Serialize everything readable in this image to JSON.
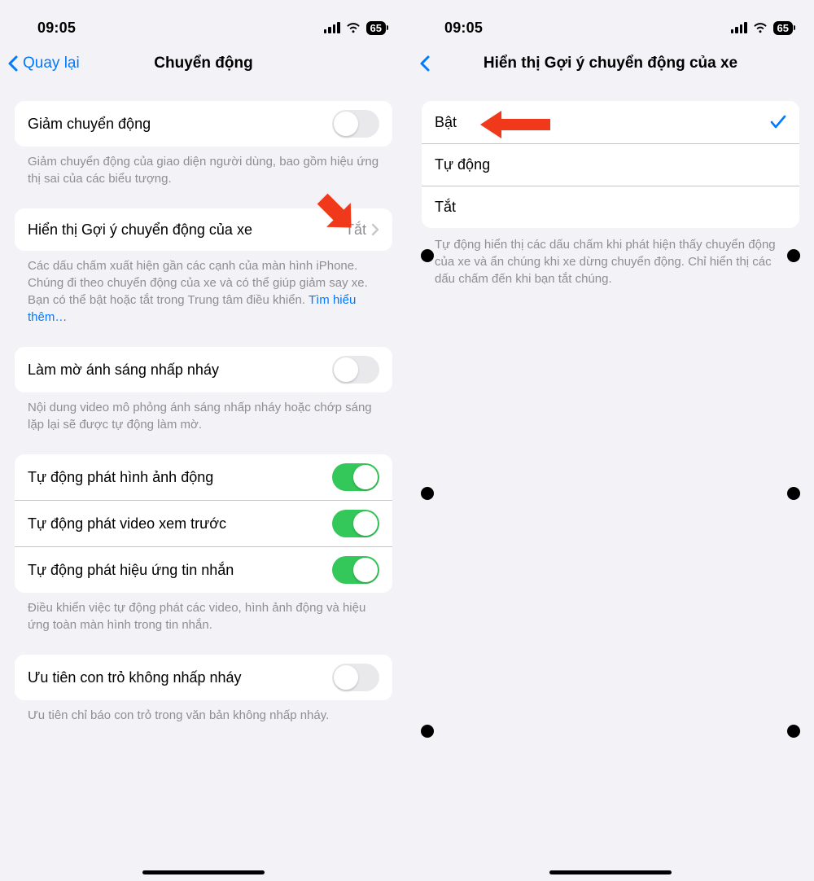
{
  "status": {
    "time": "09:05",
    "battery": "65"
  },
  "left": {
    "nav": {
      "back": "Quay lại",
      "title": "Chuyển động"
    },
    "reduce_motion": {
      "label": "Giảm chuyển động"
    },
    "reduce_motion_footer": "Giảm chuyển động của giao diện người dùng, bao gồm hiệu ứng thị sai của các biểu tượng.",
    "motion_cues": {
      "label": "Hiển thị Gợi ý chuyển động của xe",
      "value": "Tắt"
    },
    "motion_cues_footer": "Các dấu chấm xuất hiện gần các cạnh của màn hình iPhone. Chúng đi theo chuyển động của xe và có thể giúp giảm say xe. Bạn có thể bật hoặc tắt trong Trung tâm điều khiển. ",
    "motion_cues_link": "Tìm hiểu thêm…",
    "dim_flash": {
      "label": "Làm mờ ánh sáng nhấp nháy"
    },
    "dim_flash_footer": "Nội dung video mô phỏng ánh sáng nhấp nháy hoặc chớp sáng lặp lại sẽ được tự động làm mờ.",
    "auto_group": {
      "item1": "Tự động phát hình ảnh động",
      "item2": "Tự động phát video xem trước",
      "item3": "Tự động phát hiệu ứng tin nhắn"
    },
    "auto_footer": "Điều khiển việc tự động phát các video, hình ảnh động và hiệu ứng toàn màn hình trong tin nhắn.",
    "blink_cursor": {
      "label": "Ưu tiên con trỏ không nhấp nháy"
    },
    "blink_cursor_footer": "Ưu tiên chỉ báo con trỏ trong văn bản không nhấp nháy."
  },
  "right": {
    "nav": {
      "title": "Hiển thị Gợi ý chuyển động của xe"
    },
    "options": {
      "on": "Bật",
      "auto": "Tự động",
      "off": "Tắt"
    },
    "footer": "Tự động hiển thị các dấu chấm khi phát hiện thấy chuyển động của xe và ẩn chúng khi xe dừng chuyển động. Chỉ hiển thị các dấu chấm đến khi bạn tắt chúng."
  }
}
